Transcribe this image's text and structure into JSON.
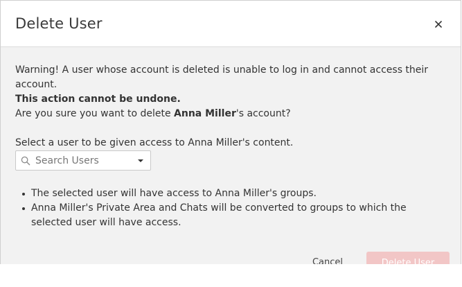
{
  "dialog": {
    "title": "Delete User",
    "close_icon": "close-icon"
  },
  "warning": {
    "line1": "Warning! A user whose account is deleted is unable to log in and cannot access their account.",
    "line2": "This action cannot be undone.",
    "confirm_prefix": "Are you sure you want to delete ",
    "user_name": "Anna Miller",
    "confirm_suffix": "'s account?"
  },
  "transfer": {
    "instruction": "Select a user to be given access to Anna Miller's content."
  },
  "search": {
    "placeholder": "Search Users",
    "value": "",
    "icon": "search-icon",
    "caret_icon": "caret-down-icon"
  },
  "notes": [
    "The selected user will have access to Anna Miller's groups.",
    "Anna Miller's Private Area and Chats will be converted to groups to which the selected user will have access."
  ],
  "footer": {
    "cancel_label": "Cancel",
    "delete_label": "Delete User"
  },
  "colors": {
    "header_bg": "#ffffff",
    "body_bg": "#f2f2f2",
    "delete_button_disabled": "#f2c6c6"
  }
}
